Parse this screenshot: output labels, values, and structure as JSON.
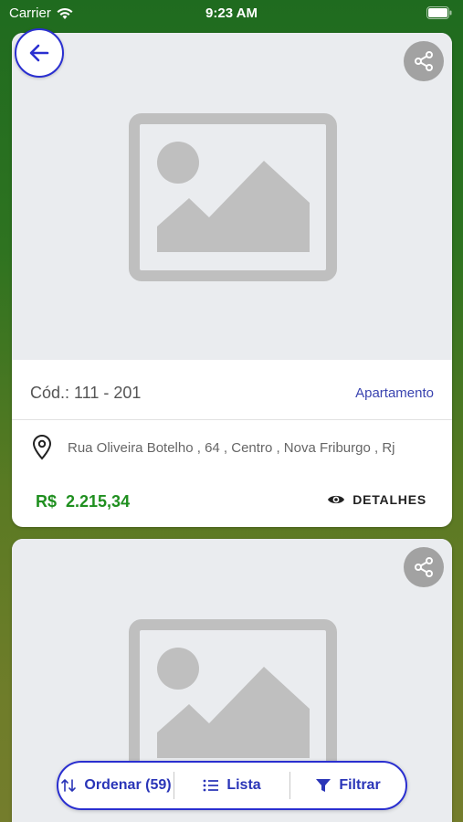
{
  "status_bar": {
    "carrier": "Carrier",
    "time": "9:23 AM"
  },
  "listings": [
    {
      "code": "Cód.: 111 - 201",
      "type": "Apartamento",
      "address": "Rua Oliveira Botelho , 64 , Centro , Nova Friburgo , Rj",
      "price": "R$  2.215,34",
      "details_label": "DETALHES"
    }
  ],
  "bottom_bar": {
    "sort_label": "Ordenar (59)",
    "list_label": "Lista",
    "filter_label": "Filtrar"
  },
  "colors": {
    "accent": "#2a2fd0",
    "price": "#1f8f1f",
    "gradient_top": "#1f6b1f",
    "gradient_bottom": "#747d2c"
  },
  "icons": [
    "wifi-icon",
    "battery-icon",
    "back-arrow-icon",
    "share-icon",
    "image-placeholder-icon",
    "location-pin-icon",
    "eye-icon",
    "sort-icon",
    "list-icon",
    "filter-icon"
  ]
}
